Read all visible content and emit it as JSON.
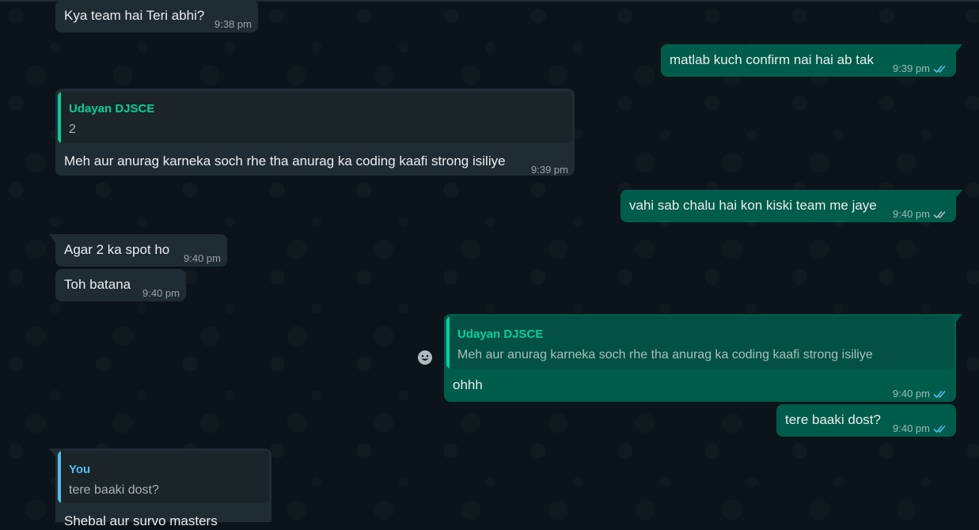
{
  "chat": {
    "colors": {
      "incoming": "#202c33",
      "outgoing": "#005c4b",
      "quote_green": "#06cf9c",
      "quote_blue": "#53bdeb",
      "read_ticks": "#53bdeb"
    },
    "messages": [
      {
        "id": "m1",
        "direction": "incoming",
        "text": "Kya team hai Teri abhi?",
        "time": "9:38 pm"
      },
      {
        "id": "m2",
        "direction": "outgoing",
        "text": "matlab kuch confirm nai hai ab tak",
        "time": "9:39 pm",
        "status": "read"
      },
      {
        "id": "m3",
        "direction": "incoming",
        "quote": {
          "author": "Udayan DJSCE",
          "text": "2"
        },
        "text": "Meh aur anurag karneka soch rhe tha anurag ka coding kaafi strong isiliye",
        "time": "9:39 pm"
      },
      {
        "id": "m4",
        "direction": "outgoing",
        "text": "vahi sab chalu hai kon kiski team me jaye",
        "time": "9:40 pm",
        "status": "delivered"
      },
      {
        "id": "m5",
        "direction": "incoming",
        "text": "Agar 2 ka spot ho",
        "time": "9:40 pm"
      },
      {
        "id": "m6",
        "direction": "incoming",
        "text": "Toh batana",
        "time": "9:40 pm"
      },
      {
        "id": "m7",
        "direction": "outgoing",
        "quote": {
          "author": "Udayan DJSCE",
          "text": "Meh aur anurag karneka soch rhe tha anurag ka coding kaafi strong isiliye"
        },
        "text": "ohhh",
        "time": "9:40 pm",
        "status": "read",
        "reaction_icon": "emoji-smile-icon"
      },
      {
        "id": "m8",
        "direction": "outgoing",
        "text": "tere baaki dost?",
        "time": "9:40 pm",
        "status": "read"
      },
      {
        "id": "m9",
        "direction": "incoming",
        "quote": {
          "author": "You",
          "text": "tere baaki dost?"
        },
        "text": "Shebal aur survo masters",
        "time": ""
      }
    ]
  }
}
